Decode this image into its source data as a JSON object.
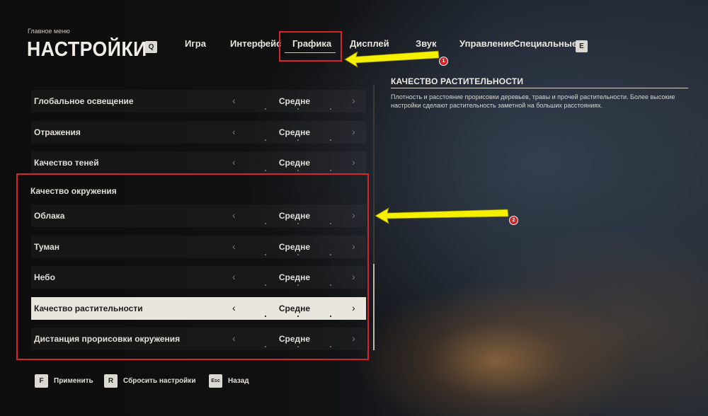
{
  "header": {
    "breadcrumb": "Главное меню",
    "title": "НАСТРОЙКИ",
    "prev_key": "Q",
    "next_key": "E",
    "tabs": [
      {
        "label": "Игра"
      },
      {
        "label": "Интерфейс"
      },
      {
        "label": "Графика",
        "active": true
      },
      {
        "label": "Дисплей"
      },
      {
        "label": "Звук"
      },
      {
        "label": "Управление"
      },
      {
        "label": "Специальные"
      }
    ]
  },
  "settings": {
    "rows": [
      {
        "label": "Глобальное освещение",
        "value": "Средне"
      },
      {
        "label": "Отражения",
        "value": "Средне"
      },
      {
        "label": "Качество теней",
        "value": "Средне"
      }
    ],
    "section": {
      "title": "Качество окружения",
      "rows": [
        {
          "label": "Облака",
          "value": "Средне"
        },
        {
          "label": "Туман",
          "value": "Средне"
        },
        {
          "label": "Небо",
          "value": "Средне"
        },
        {
          "label": "Качество растительности",
          "value": "Средне",
          "selected": true
        },
        {
          "label": "Дистанция прорисовки окружения",
          "value": "Средне"
        }
      ]
    },
    "arrow_left": "‹",
    "arrow_right": "›"
  },
  "detail": {
    "title": "КАЧЕСТВО РАСТИТЕЛЬНОСТИ",
    "description": "Плотность и расстояние прорисовки деревьев, травы и прочей растительности. Более высокие настройки сделают растительность заметной на больших расстояниях."
  },
  "footer": {
    "buttons": [
      {
        "key": "F",
        "label": "Применить"
      },
      {
        "key": "R",
        "label": "Сбросить настройки"
      },
      {
        "key": "Esc",
        "label": "Назад"
      }
    ]
  },
  "annotations": {
    "callouts": [
      "1",
      "2"
    ],
    "highlight_color": "#d8232a",
    "arrow_color": "#f5f000"
  }
}
